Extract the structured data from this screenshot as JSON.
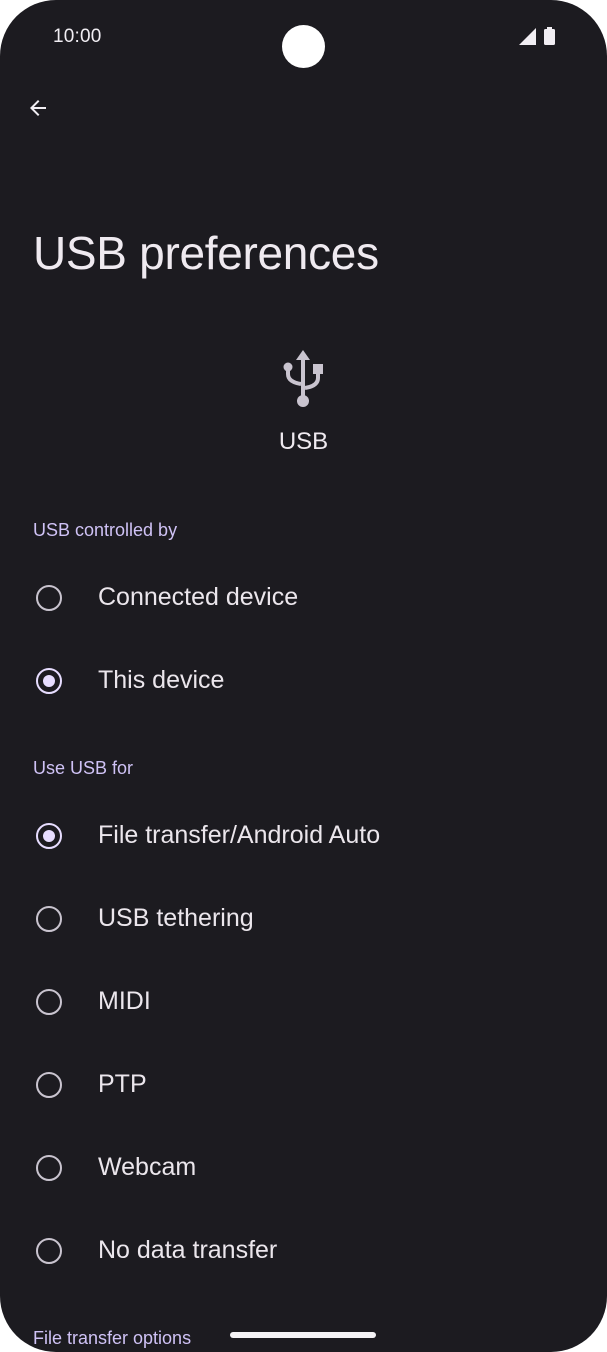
{
  "status_bar": {
    "time": "10:00",
    "icons": [
      "signal-icon",
      "battery-icon"
    ]
  },
  "toolbar": {
    "back_icon": "arrow-back-icon"
  },
  "page": {
    "title": "USB preferences"
  },
  "usb_header": {
    "icon": "usb-icon",
    "label": "USB"
  },
  "controlled_by": {
    "header": "USB controlled by",
    "options": [
      {
        "label": "Connected device",
        "selected": false
      },
      {
        "label": "This device",
        "selected": true
      }
    ]
  },
  "use_for": {
    "header": "Use USB for",
    "options": [
      {
        "label": "File transfer/Android Auto",
        "selected": true
      },
      {
        "label": "USB tethering",
        "selected": false
      },
      {
        "label": "MIDI",
        "selected": false
      },
      {
        "label": "PTP",
        "selected": false
      },
      {
        "label": "Webcam",
        "selected": false
      },
      {
        "label": "No data transfer",
        "selected": false
      }
    ]
  },
  "file_transfer_options": {
    "header": "File transfer options"
  },
  "colors": {
    "background": "#1c1b20",
    "accent": "#cfc2f5",
    "radio_selected": "#e7ddff",
    "text": "#ebe6ec"
  }
}
